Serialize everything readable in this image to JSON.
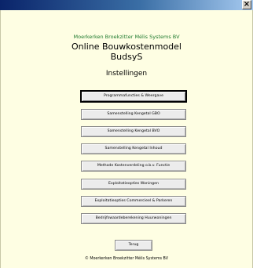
{
  "window": {
    "close_label": "×"
  },
  "header": {
    "company": "Moerkerken Broekzitter Mélis Systems BV",
    "title": "Online Bouwkostenmodel",
    "subtitle": "BudsyS",
    "section": "Instellingen"
  },
  "menu": [
    "Programmafuncties & Weergave",
    "Samenstelling Kengetal GBO",
    "Samenstelling Kengetal BVO",
    "Samenstelling Kengetal Inhoud",
    "Methode Kostenverdeling o.b.v. Functie",
    "Exploitatieopties Woningen",
    "Exploitatieopties Commercieel & Parkeren",
    "Bedrijfswaardeberekening Huurwoningen"
  ],
  "back_label": "Terug",
  "footer": "© Moerkerken Broekzitter Mélis Systems BV"
}
